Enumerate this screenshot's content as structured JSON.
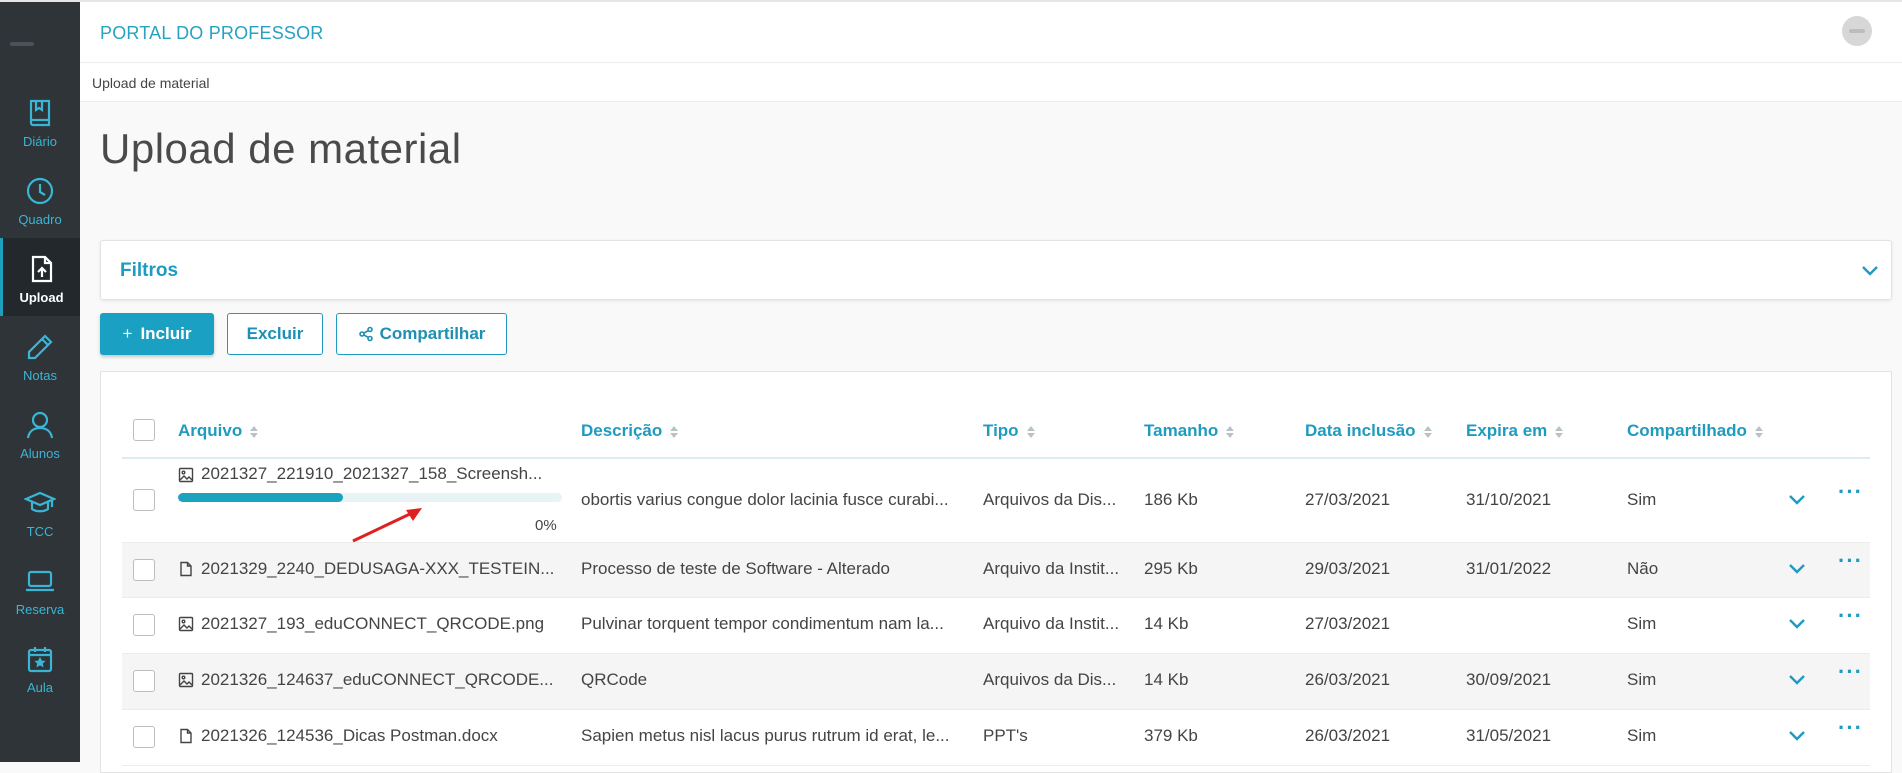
{
  "header": {
    "portal_title": "PORTAL DO PROFESSOR"
  },
  "breadcrumb": "Upload de material",
  "page_title": "Upload de material",
  "sidebar": {
    "items": [
      {
        "label": "Diário",
        "icon": "book-icon",
        "active": false
      },
      {
        "label": "Quadro",
        "icon": "clock-icon",
        "active": false
      },
      {
        "label": "Upload",
        "icon": "upload-file-icon",
        "active": true
      },
      {
        "label": "Notas",
        "icon": "pencil-icon",
        "active": false
      },
      {
        "label": "Alunos",
        "icon": "user-icon",
        "active": false
      },
      {
        "label": "TCC",
        "icon": "graduation-cap-icon",
        "active": false
      },
      {
        "label": "Reserva",
        "icon": "laptop-icon",
        "active": false
      },
      {
        "label": "Aula",
        "icon": "calendar-star-icon",
        "active": false
      }
    ]
  },
  "filters": {
    "title": "Filtros"
  },
  "toolbar": {
    "include_label": "Incluir",
    "include_prefix": "+",
    "delete_label": "Excluir",
    "share_label": "Compartilhar"
  },
  "table": {
    "columns": [
      "Arquivo",
      "Descrição",
      "Tipo",
      "Tamanho",
      "Data inclusão",
      "Expira em",
      "Compartilhado"
    ],
    "rows": [
      {
        "icon": "image-icon",
        "file": "2021327_221910_2021327_158_Screensh...",
        "description": "obortis varius congue dolor lacinia fusce curabi...",
        "type": "Arquivos da Dis...",
        "size": "186 Kb",
        "created": "27/03/2021",
        "expires": "31/10/2021",
        "shared": "Sim",
        "progress": 0.43,
        "progress_text": "0%"
      },
      {
        "icon": "document-icon",
        "file": "2021329_2240_DEDUSAGA-XXX_TESTEIN...",
        "description": "Processo de teste de Software - Alterado",
        "type": "Arquivo da Instit...",
        "size": "295 Kb",
        "created": "29/03/2021",
        "expires": "31/01/2022",
        "shared": "Não"
      },
      {
        "icon": "image-icon",
        "file": "2021327_193_eduCONNECT_QRCODE.png",
        "description": "Pulvinar torquent tempor condimentum nam la...",
        "type": "Arquivo da Instit...",
        "size": "14 Kb",
        "created": "27/03/2021",
        "expires": "",
        "shared": "Sim"
      },
      {
        "icon": "image-icon",
        "file": "2021326_124637_eduCONNECT_QRCODE...",
        "description": "QRCode",
        "type": "Arquivos da Dis...",
        "size": "14 Kb",
        "created": "26/03/2021",
        "expires": "30/09/2021",
        "shared": "Sim"
      },
      {
        "icon": "document-icon",
        "file": "2021326_124536_Dicas Postman.docx",
        "description": "Sapien metus nisl lacus purus rutrum id erat, le...",
        "type": "PPT's",
        "size": "379 Kb",
        "created": "26/03/2021",
        "expires": "31/05/2021",
        "shared": "Sim"
      }
    ]
  },
  "colors": {
    "accent": "#1f9bc0",
    "sidebar_bg": "#2e3438",
    "annotation_arrow": "#e02020"
  }
}
